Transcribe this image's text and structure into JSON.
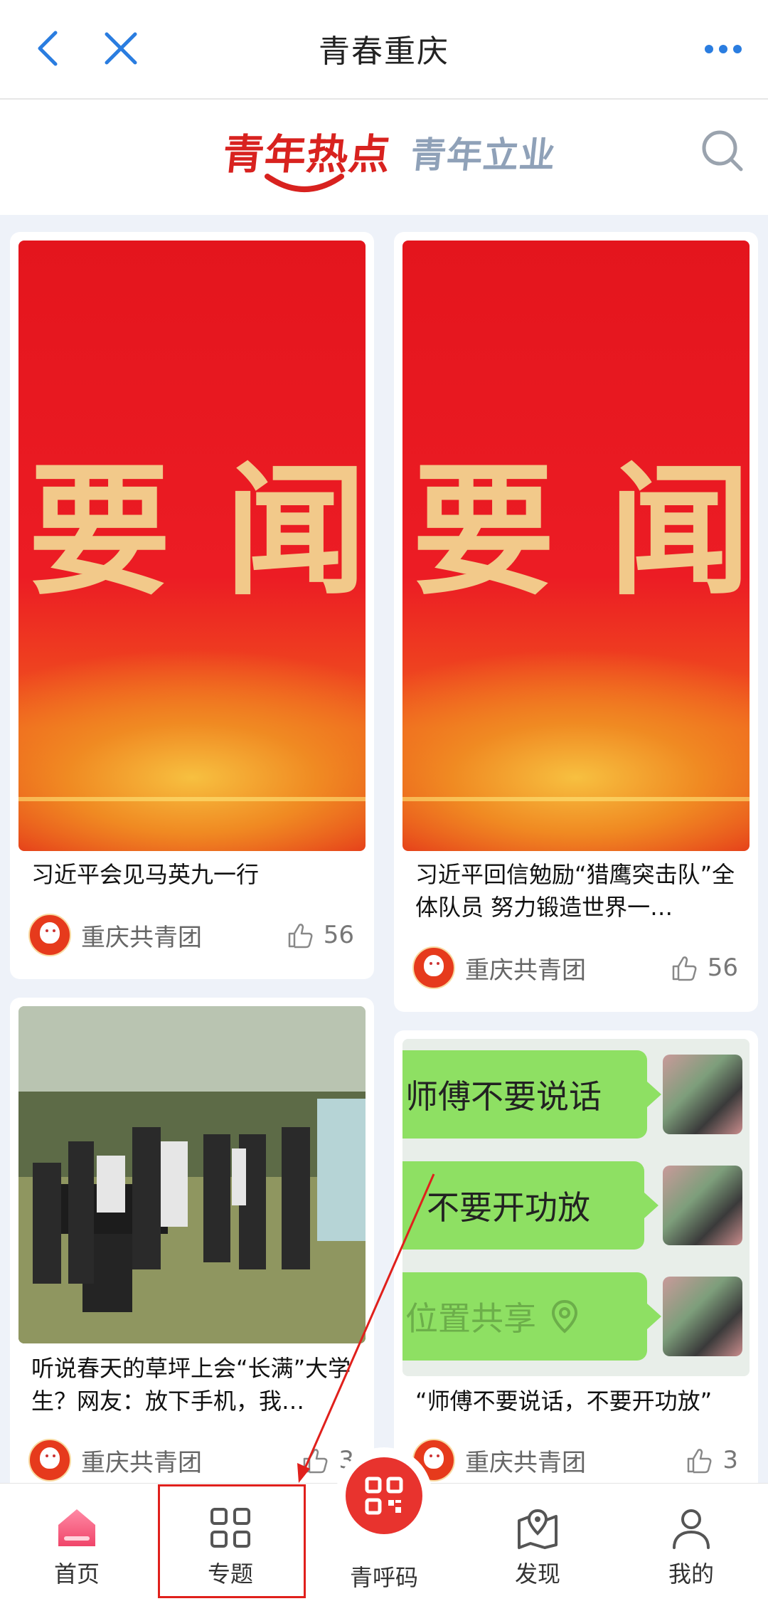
{
  "header": {
    "title": "青春重庆"
  },
  "tabs": {
    "active": "青年热点",
    "other": "青年立业"
  },
  "cards": [
    {
      "caption": "习近平会见马英九一行",
      "thumb_text": [
        "要",
        "闻"
      ],
      "author": "重庆共青团",
      "likes": "56"
    },
    {
      "caption": "习近平回信勉励“猎鹰突击队”全体队员 努力锻造世界一…",
      "thumb_text": [
        "要",
        "闻"
      ],
      "author": "重庆共青团",
      "likes": "56"
    },
    {
      "caption": "听说春天的草坪上会“长满”大学生？网友：放下手机，我…",
      "author": "重庆共青团",
      "likes": "3"
    },
    {
      "caption": "“师傅不要说话，不要开功放”",
      "chat_bubbles": [
        "师傅不要说话",
        "不要开功放",
        "位置共享"
      ],
      "author": "重庆共青团",
      "likes": "3"
    }
  ],
  "bottom_nav": [
    {
      "label": "首页",
      "icon": "home-icon"
    },
    {
      "label": "专题",
      "icon": "grid-icon"
    },
    {
      "label": "青呼码",
      "icon": "qr-code-icon"
    },
    {
      "label": "发现",
      "icon": "map-pin-icon"
    },
    {
      "label": "我的",
      "icon": "person-icon"
    }
  ],
  "colors": {
    "accent": "#d8221f",
    "inactive_tab": "#8fa1b8",
    "annotation": "#e0201c"
  }
}
